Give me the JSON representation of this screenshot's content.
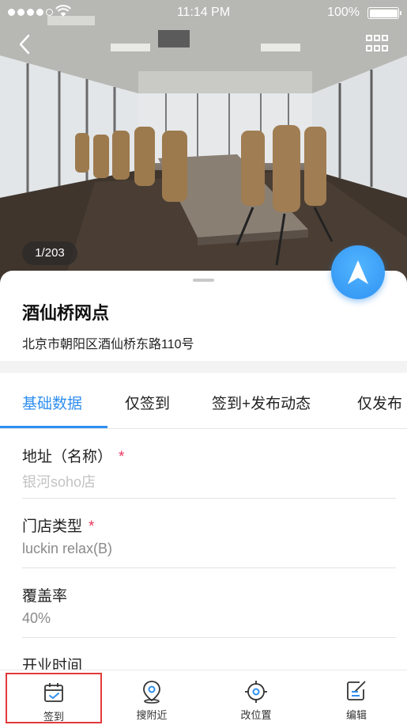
{
  "status_bar": {
    "time": "11:14 PM",
    "battery": "100%"
  },
  "hero": {
    "photo_counter": "1/203"
  },
  "store": {
    "name": "酒仙桥网点",
    "address": "北京市朝阳区酒仙桥东路110号"
  },
  "tabs": [
    {
      "label": "基础数据",
      "active": true
    },
    {
      "label": "仅签到",
      "active": false
    },
    {
      "label": "签到+发布动态",
      "active": false
    },
    {
      "label": "仅发布",
      "active": false
    }
  ],
  "fields": [
    {
      "label": "地址（名称）",
      "required": "*",
      "value": "银河soho店"
    },
    {
      "label": "门店类型",
      "required": "*",
      "value": "luckin relax(B)"
    },
    {
      "label": "覆盖率",
      "value": "40%"
    },
    {
      "label": "开业时间"
    }
  ],
  "toolbar": {
    "items": [
      {
        "label": "签到",
        "icon": "calendar-check-icon"
      },
      {
        "label": "搜附近",
        "icon": "location-pin-icon"
      },
      {
        "label": "改位置",
        "icon": "crosshair-icon"
      },
      {
        "label": "编辑",
        "icon": "edit-icon"
      }
    ]
  },
  "colors": {
    "accent": "#2f8ff0",
    "required": "#e8365d",
    "selection": "#e23a3a"
  }
}
